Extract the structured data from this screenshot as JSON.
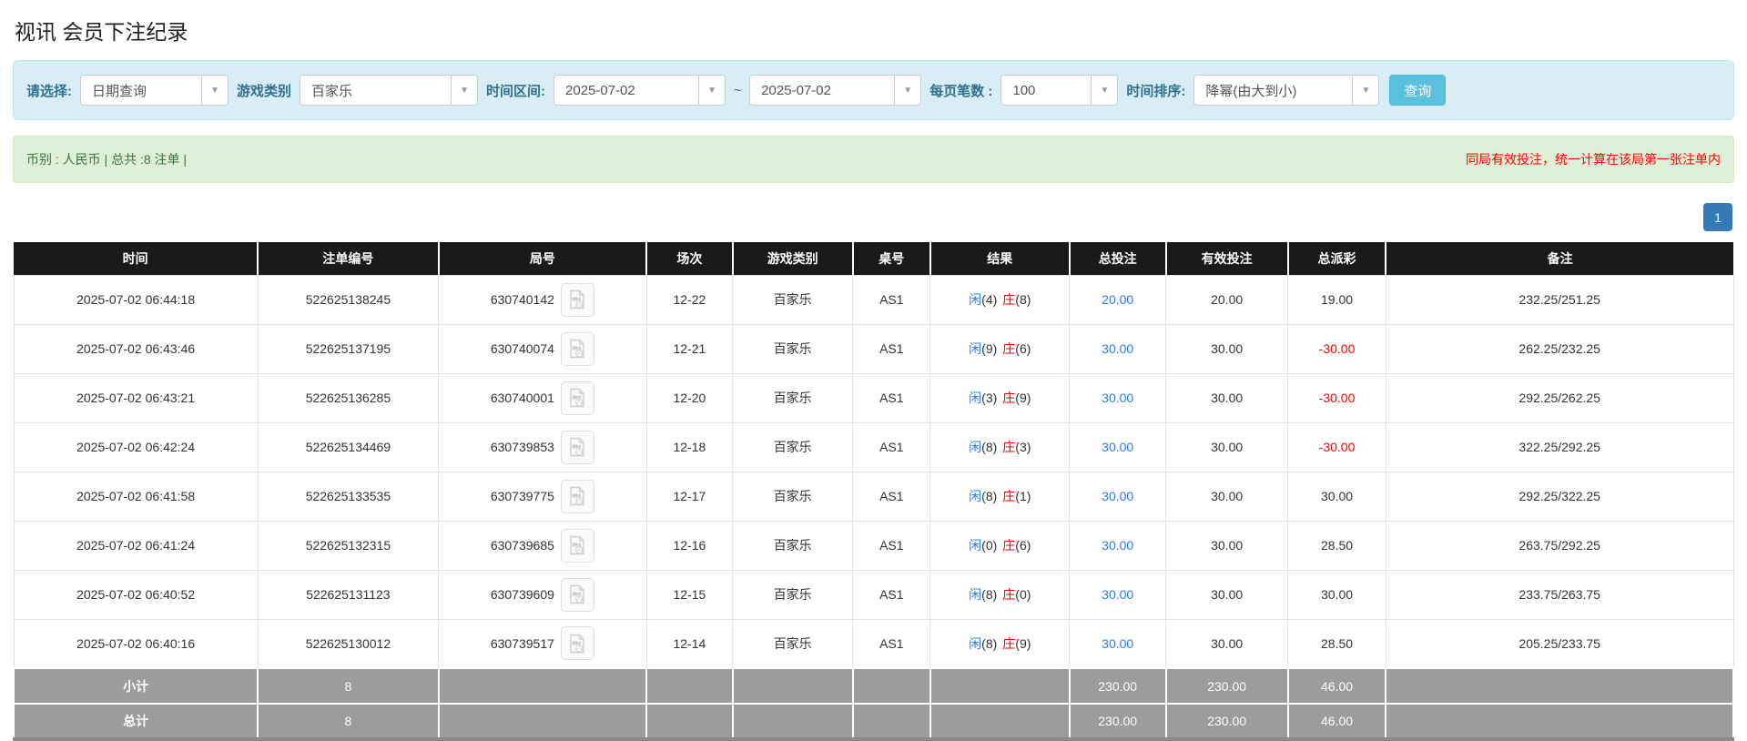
{
  "page": {
    "title": "视讯 会员下注纪录"
  },
  "colors": {
    "filter_bg": "#d9edf7",
    "filter_label": "#31708f",
    "search_button": "#5bc0de",
    "info_green_bg": "#dff0d8",
    "info_green_text": "#3c763d",
    "note_red": "#ff0000",
    "link_blue": "#2a7cf2",
    "player_blue": "#2a7cf2",
    "banker_red": "#e60000",
    "negative_red": "#ff0000",
    "header_black": "#1a1a1a",
    "summary_gray": "#9c9c9c",
    "pagination_active": "#337ab7"
  },
  "filters": {
    "query_type": {
      "label": "请选择:",
      "value": "日期查询"
    },
    "game_category": {
      "label": "游戏类别",
      "value": "百家乐"
    },
    "time_range": {
      "label": "时间区间:",
      "from": "2025-07-02",
      "separator": "~",
      "to": "2025-07-02"
    },
    "page_size": {
      "label": "每页笔数 :",
      "value": "100"
    },
    "time_sort": {
      "label": "时间排序:",
      "value": "降幂(由大到小)"
    },
    "search_button": "查询"
  },
  "info_bar": {
    "left": "币别 : 人民币 | 总共 :8 注单 |",
    "right": "同局有效投注，统一计算在该局第一张注单内"
  },
  "pagination": {
    "pages": [
      "1"
    ]
  },
  "table": {
    "columns": [
      "时间",
      "注单编号",
      "局号",
      "场次",
      "游戏类别",
      "桌号",
      "结果",
      "总投注",
      "有效投注",
      "总派彩",
      "备注"
    ],
    "rows": [
      {
        "time": "2025-07-02 06:44:18",
        "bet_no": "522625138245",
        "round_no": "630740142",
        "session": "12-22",
        "game": "百家乐",
        "table_no": "AS1",
        "result": {
          "player_label": "闲",
          "player_num": "(4)",
          "banker_label": "庄",
          "banker_num": "(8)"
        },
        "total_bet": "20.00",
        "valid_bet": "20.00",
        "payout": "19.00",
        "remark": "232.25/251.25"
      },
      {
        "time": "2025-07-02 06:43:46",
        "bet_no": "522625137195",
        "round_no": "630740074",
        "session": "12-21",
        "game": "百家乐",
        "table_no": "AS1",
        "result": {
          "player_label": "闲",
          "player_num": "(9)",
          "banker_label": "庄",
          "banker_num": "(6)"
        },
        "total_bet": "30.00",
        "valid_bet": "30.00",
        "payout": "-30.00",
        "remark": "262.25/232.25"
      },
      {
        "time": "2025-07-02 06:43:21",
        "bet_no": "522625136285",
        "round_no": "630740001",
        "session": "12-20",
        "game": "百家乐",
        "table_no": "AS1",
        "result": {
          "player_label": "闲",
          "player_num": "(3)",
          "banker_label": "庄",
          "banker_num": "(9)"
        },
        "total_bet": "30.00",
        "valid_bet": "30.00",
        "payout": "-30.00",
        "remark": "292.25/262.25"
      },
      {
        "time": "2025-07-02 06:42:24",
        "bet_no": "522625134469",
        "round_no": "630739853",
        "session": "12-18",
        "game": "百家乐",
        "table_no": "AS1",
        "result": {
          "player_label": "闲",
          "player_num": "(8)",
          "banker_label": "庄",
          "banker_num": "(3)"
        },
        "total_bet": "30.00",
        "valid_bet": "30.00",
        "payout": "-30.00",
        "remark": "322.25/292.25"
      },
      {
        "time": "2025-07-02 06:41:58",
        "bet_no": "522625133535",
        "round_no": "630739775",
        "session": "12-17",
        "game": "百家乐",
        "table_no": "AS1",
        "result": {
          "player_label": "闲",
          "player_num": "(8)",
          "banker_label": "庄",
          "banker_num": "(1)"
        },
        "total_bet": "30.00",
        "valid_bet": "30.00",
        "payout": "30.00",
        "remark": "292.25/322.25"
      },
      {
        "time": "2025-07-02 06:41:24",
        "bet_no": "522625132315",
        "round_no": "630739685",
        "session": "12-16",
        "game": "百家乐",
        "table_no": "AS1",
        "result": {
          "player_label": "闲",
          "player_num": "(0)",
          "banker_label": "庄",
          "banker_num": "(6)"
        },
        "total_bet": "30.00",
        "valid_bet": "30.00",
        "payout": "28.50",
        "remark": "263.75/292.25"
      },
      {
        "time": "2025-07-02 06:40:52",
        "bet_no": "522625131123",
        "round_no": "630739609",
        "session": "12-15",
        "game": "百家乐",
        "table_no": "AS1",
        "result": {
          "player_label": "闲",
          "player_num": "(8)",
          "banker_label": "庄",
          "banker_num": "(0)"
        },
        "total_bet": "30.00",
        "valid_bet": "30.00",
        "payout": "30.00",
        "remark": "233.75/263.75"
      },
      {
        "time": "2025-07-02 06:40:16",
        "bet_no": "522625130012",
        "round_no": "630739517",
        "session": "12-14",
        "game": "百家乐",
        "table_no": "AS1",
        "result": {
          "player_label": "闲",
          "player_num": "(8)",
          "banker_label": "庄",
          "banker_num": "(9)"
        },
        "total_bet": "30.00",
        "valid_bet": "30.00",
        "payout": "28.50",
        "remark": "205.25/233.75"
      }
    ],
    "footer_rows": [
      {
        "label": "小计",
        "count": "8",
        "total_bet": "230.00",
        "valid_bet": "230.00",
        "payout": "46.00"
      },
      {
        "label": "总计",
        "count": "8",
        "total_bet": "230.00",
        "valid_bet": "230.00",
        "payout": "46.00"
      }
    ]
  }
}
